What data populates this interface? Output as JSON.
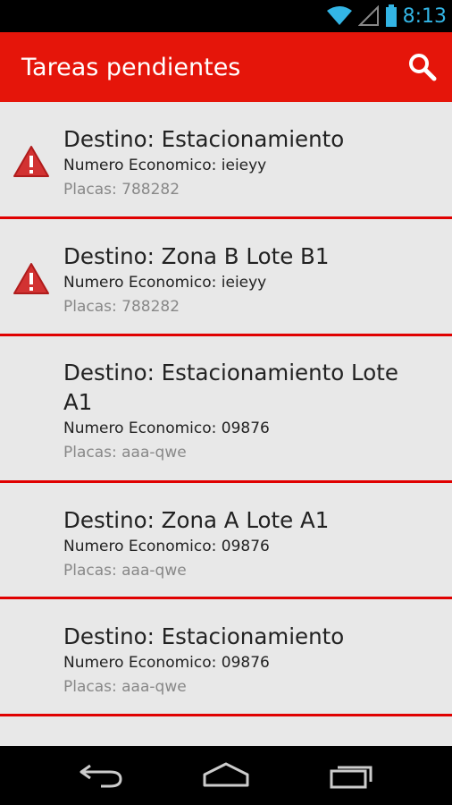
{
  "status_bar": {
    "time": "8:13"
  },
  "action_bar": {
    "title": "Tareas pendientes",
    "search_icon": "search-icon"
  },
  "tasks": [
    {
      "destino": "Destino: Estacionamiento",
      "numero": "Numero Economico: ieieyy",
      "placas": "Placas: 788282",
      "warning": true
    },
    {
      "destino": "Destino: Zona B Lote B1",
      "numero": "Numero Economico: ieieyy",
      "placas": "Placas: 788282",
      "warning": true
    },
    {
      "destino": "Destino: Estacionamiento Lote A1",
      "numero": "Numero Economico: 09876",
      "placas": "Placas: aaa-qwe",
      "warning": false
    },
    {
      "destino": "Destino: Zona A Lote A1",
      "numero": "Numero Economico: 09876",
      "placas": "Placas: aaa-qwe",
      "warning": false
    },
    {
      "destino": "Destino: Estacionamiento",
      "numero": "Numero Economico: 09876",
      "placas": "Placas: aaa-qwe",
      "warning": false
    }
  ],
  "colors": {
    "accent": "#e5150a",
    "divider": "#e00000",
    "status": "#33b5e5"
  }
}
